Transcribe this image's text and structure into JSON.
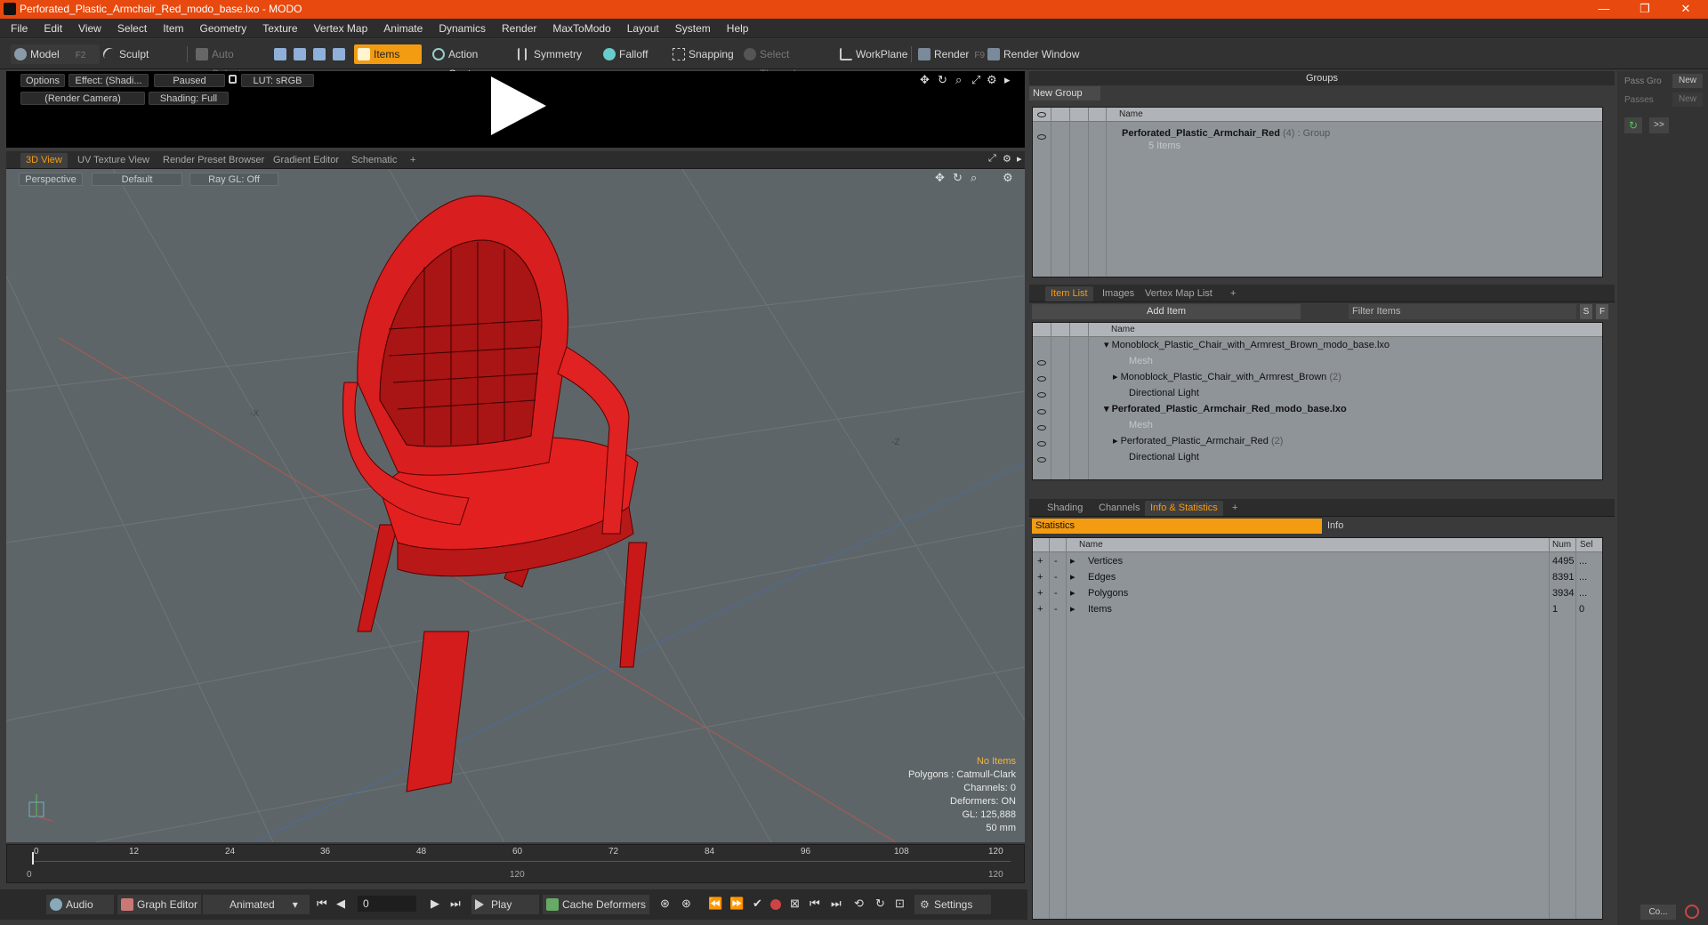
{
  "window": {
    "title": "Perforated_Plastic_Armchair_Red_modo_base.lxo - MODO",
    "minimize": "—",
    "maximize": "❐",
    "close": "✕"
  },
  "menu": [
    "File",
    "Edit",
    "View",
    "Select",
    "Item",
    "Geometry",
    "Texture",
    "Vertex Map",
    "Animate",
    "Dynamics",
    "Render",
    "MaxToModo",
    "Layout",
    "System",
    "Help"
  ],
  "toolbar": {
    "model": "Model",
    "model_key": "F2",
    "sculpt": "Sculpt",
    "auto_select": "Auto Select",
    "items": "Items",
    "action_center": "Action Center",
    "symmetry": "Symmetry",
    "falloff": "Falloff",
    "snapping": "Snapping",
    "select_through": "Select Through",
    "workplane": "WorkPlane",
    "render": "Render",
    "render_key": "F9",
    "render_window": "Render Window"
  },
  "preview": {
    "options": "Options",
    "effect": "Effect: (Shadi...",
    "paused": "Paused",
    "lut": "LUT: sRGB",
    "camera": "(Render Camera)",
    "shading": "Shading: Full"
  },
  "view_tabs": [
    "3D View",
    "UV Texture View",
    "Render Preset Browser",
    "Gradient Editor",
    "Schematic",
    "+"
  ],
  "viewport": {
    "perspective": "Perspective",
    "default": "Default",
    "raygl": "Ray GL: Off",
    "axis_x": "-X",
    "axis_z": "-Z",
    "no_items": "No Items",
    "polygons": "Polygons : Catmull-Clark",
    "channels": "Channels: 0",
    "deformers": "Deformers: ON",
    "gl": "GL: 125,888",
    "focal": "50 mm"
  },
  "timeline": {
    "ticks": [
      "0",
      "12",
      "24",
      "36",
      "48",
      "60",
      "72",
      "84",
      "96",
      "108",
      "120"
    ],
    "sub_start": "0",
    "sub_mid": "120",
    "sub_end": "120"
  },
  "transport": {
    "audio": "Audio",
    "graph_editor": "Graph Editor",
    "animated": "Animated",
    "frame": "0",
    "play": "Play",
    "cache": "Cache Deformers",
    "settings": "Settings"
  },
  "groups": {
    "title": "Groups",
    "new_group": "New Group",
    "col_name": "Name",
    "group_name": "Perforated_Plastic_Armchair_Red",
    "group_count": "(4)",
    "group_type": ": Group",
    "group_items": "5 Items"
  },
  "far_right": {
    "pass_gro": "Pass Gro",
    "new1": "New",
    "passes": "Passes",
    "new2": "New",
    "more": ">>",
    "co": "Co..."
  },
  "item_tabs": [
    "Item List",
    "Images",
    "Vertex Map List",
    "+"
  ],
  "item_list": {
    "add_item": "Add Item",
    "filter": "Filter Items",
    "s": "S",
    "f": "F",
    "col_name": "Name",
    "rows": [
      {
        "label": "Monoblock_Plastic_Chair_with_Armrest_Brown_modo_base.lxo",
        "count": ""
      },
      {
        "label": "Mesh",
        "count": ""
      },
      {
        "label": "Monoblock_Plastic_Chair_with_Armrest_Brown",
        "count": "(2)"
      },
      {
        "label": "Directional Light",
        "count": ""
      },
      {
        "label": "Perforated_Plastic_Armchair_Red_modo_base.lxo",
        "count": ""
      },
      {
        "label": "Mesh",
        "count": ""
      },
      {
        "label": "Perforated_Plastic_Armchair_Red",
        "count": "(2)"
      },
      {
        "label": "Directional Light",
        "count": ""
      }
    ]
  },
  "info_tabs": [
    "Shading",
    "Channels",
    "Info & Statistics",
    "+"
  ],
  "stats": {
    "statistics": "Statistics",
    "info": "Info",
    "col_name": "Name",
    "col_num": "Num",
    "col_sel": "Sel",
    "rows": [
      {
        "name": "Vertices",
        "num": "4495",
        "sel": "..."
      },
      {
        "name": "Edges",
        "num": "8391",
        "sel": "..."
      },
      {
        "name": "Polygons",
        "num": "3934",
        "sel": "..."
      },
      {
        "name": "Items",
        "num": "1",
        "sel": "0"
      }
    ]
  },
  "colors": {
    "accent": "#f39c12",
    "title_bar": "#e8490e",
    "chair": "#e02020"
  }
}
